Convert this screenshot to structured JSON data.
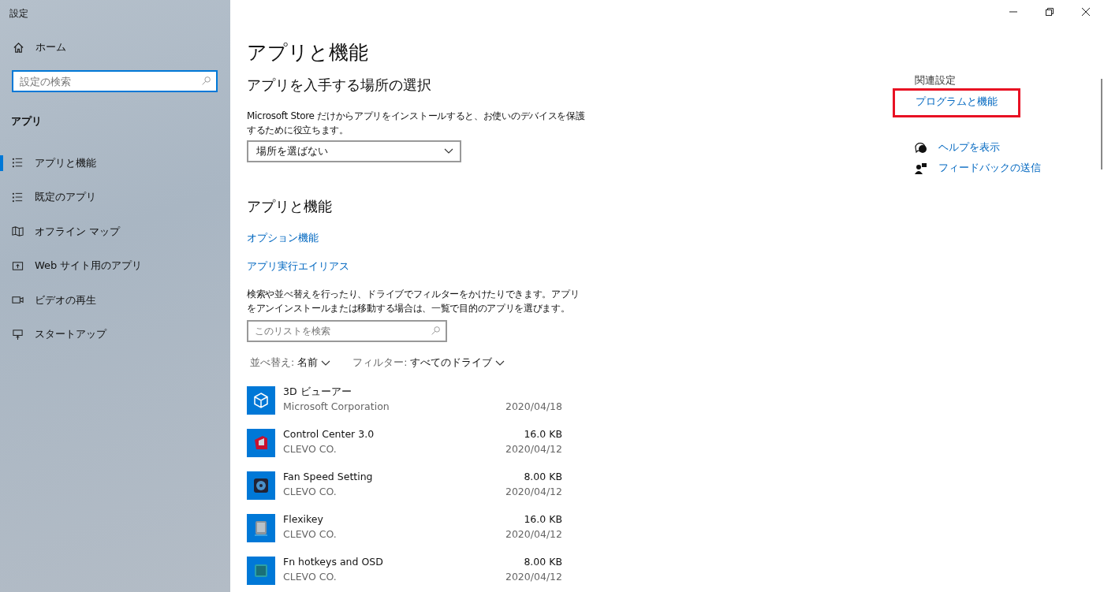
{
  "window": {
    "title": "設定"
  },
  "sidebar": {
    "home": "ホーム",
    "search": {
      "placeholder": "設定の検索"
    },
    "section": "アプリ",
    "items": [
      {
        "label": "アプリと機能",
        "selected": true
      },
      {
        "label": "既定のアプリ",
        "selected": false
      },
      {
        "label": "オフライン マップ",
        "selected": false
      },
      {
        "label": "Web サイト用のアプリ",
        "selected": false
      },
      {
        "label": "ビデオの再生",
        "selected": false
      },
      {
        "label": "スタートアップ",
        "selected": false
      }
    ]
  },
  "main": {
    "title": "アプリと機能",
    "source_section": {
      "heading": "アプリを入手する場所の選択",
      "description": "Microsoft Store だけからアプリをインストールすると、お使いのデバイスを保護するために役立ちます。",
      "dropdown": {
        "value": "場所を選ばない"
      }
    },
    "apps_section": {
      "heading": "アプリと機能",
      "links": [
        "オプション機能",
        "アプリ実行エイリアス"
      ],
      "description": "検索や並べ替えを行ったり、ドライブでフィルターをかけたりできます。アプリをアンインストールまたは移動する場合は、一覧で目的のアプリを選びます。",
      "search": {
        "placeholder": "このリストを検索"
      },
      "sort": {
        "label": "並べ替え:",
        "value": "名前"
      },
      "filter": {
        "label": "フィルター:",
        "value": "すべてのドライブ"
      },
      "apps": [
        {
          "name": "3D ビューアー",
          "publisher": "Microsoft Corporation",
          "date": "2020/04/18"
        },
        {
          "name": "Control Center 3.0",
          "publisher": "CLEVO CO.",
          "size": "16.0 KB",
          "date": "2020/04/12"
        },
        {
          "name": "Fan Speed Setting",
          "publisher": "CLEVO CO.",
          "size": "8.00 KB",
          "date": "2020/04/12"
        },
        {
          "name": "Flexikey",
          "publisher": "CLEVO CO.",
          "size": "16.0 KB",
          "date": "2020/04/12"
        },
        {
          "name": "Fn hotkeys and OSD",
          "publisher": "CLEVO CO.",
          "size": "8.00 KB",
          "date": "2020/04/12"
        }
      ]
    }
  },
  "related": {
    "heading": "関連設定",
    "links": [
      {
        "label": "プログラムと機能",
        "highlighted": true
      }
    ],
    "support": [
      {
        "label": "ヘルプを表示"
      },
      {
        "label": "フィードバックの送信"
      }
    ]
  }
}
